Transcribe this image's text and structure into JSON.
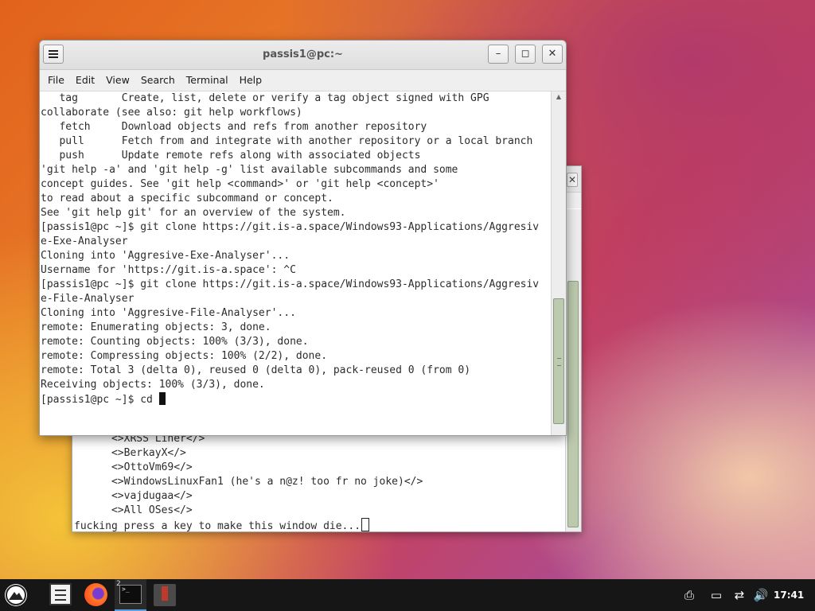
{
  "back_terminal": {
    "lines": [
      "      <>XRSS Liner</>",
      "      <>BerkayX</>",
      "      <>OttoVm69</>",
      "      <>WindowsLinuxFan1 (he's a n@z! too fr no joke)</>",
      "      <>vajdugaa</>",
      "      <>All OSes</>"
    ],
    "prompt_line": "fucking press a key to make this window die...",
    "close_glyph": "✕"
  },
  "front_terminal": {
    "title": "passis1@pc:~",
    "menu": [
      "File",
      "Edit",
      "View",
      "Search",
      "Terminal",
      "Help"
    ],
    "lines": [
      "   tag       Create, list, delete or verify a tag object signed with GPG",
      "",
      "collaborate (see also: git help workflows)",
      "   fetch     Download objects and refs from another repository",
      "   pull      Fetch from and integrate with another repository or a local branch",
      "   push      Update remote refs along with associated objects",
      "",
      "'git help -a' and 'git help -g' list available subcommands and some",
      "concept guides. See 'git help <command>' or 'git help <concept>'",
      "to read about a specific subcommand or concept.",
      "See 'git help git' for an overview of the system.",
      "[passis1@pc ~]$ git clone https://git.is-a.space/Windows93-Applications/Aggresiv",
      "e-Exe-Analyser",
      "Cloning into 'Aggresive-Exe-Analyser'...",
      "Username for 'https://git.is-a.space': ^C",
      "[passis1@pc ~]$ git clone https://git.is-a.space/Windows93-Applications/Aggresiv",
      "e-File-Analyser",
      "Cloning into 'Aggresive-File-Analyser'...",
      "remote: Enumerating objects: 3, done.",
      "remote: Counting objects: 100% (3/3), done.",
      "remote: Compressing objects: 100% (2/2), done.",
      "remote: Total 3 (delta 0), reused 0 (delta 0), pack-reused 0 (from 0)",
      "Receiving objects: 100% (3/3), done."
    ],
    "prompt": "[passis1@pc ~]$ cd ",
    "buttons": {
      "minimize": "–",
      "maximize": "◻",
      "close": "✕"
    }
  },
  "taskbar": {
    "apps": [
      "start-menu-icon",
      "file-manager-icon",
      "firefox-icon",
      "terminal-icon",
      "app-icon"
    ],
    "terminal_badge": "2",
    "terminal_glyph": ">_",
    "tray": {
      "printer": "⎙",
      "display": "▭",
      "network": "⇄",
      "volume": "🔊"
    },
    "clock": "17:41"
  }
}
